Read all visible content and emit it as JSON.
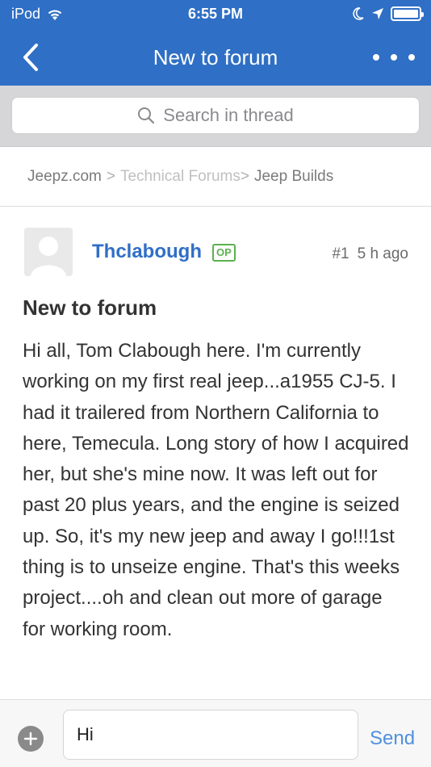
{
  "status_bar": {
    "carrier": "iPod",
    "time": "6:55 PM"
  },
  "nav": {
    "title": "New to forum"
  },
  "search": {
    "placeholder": "Search in thread"
  },
  "breadcrumb": {
    "items": [
      "Jeepz.com",
      "Technical Forums",
      "Jeep Builds"
    ]
  },
  "post": {
    "author": "Thclabough",
    "badge": "OP",
    "number": "#1",
    "time_ago": "5 h ago",
    "title": "New to forum",
    "body": "Hi all, Tom Clabough here. I'm currently working on my first real jeep...a1955 CJ-5. I had it trailered from Northern California to here, Temecula. Long story of how I acquired her, but she's mine now. It was left out for past 20 plus years, and the engine is seized up. So, it's my new jeep and away I go!!!1st thing is to unseize engine. That's this weeks project....oh and clean out more of garage for working room."
  },
  "reply": {
    "value": "Hi",
    "send_label": "Send"
  },
  "colors": {
    "accent": "#2f6fc5",
    "op_badge": "#5bb14e",
    "send": "#4f90e0"
  },
  "icons": {
    "wifi": "wifi-icon",
    "moon": "moon-icon",
    "location": "location-arrow-icon",
    "battery": "battery-icon",
    "back": "chevron-left-icon",
    "more": "more-dots-icon",
    "search": "search-icon",
    "add": "plus-circle-icon",
    "avatar": "default-avatar-icon"
  }
}
